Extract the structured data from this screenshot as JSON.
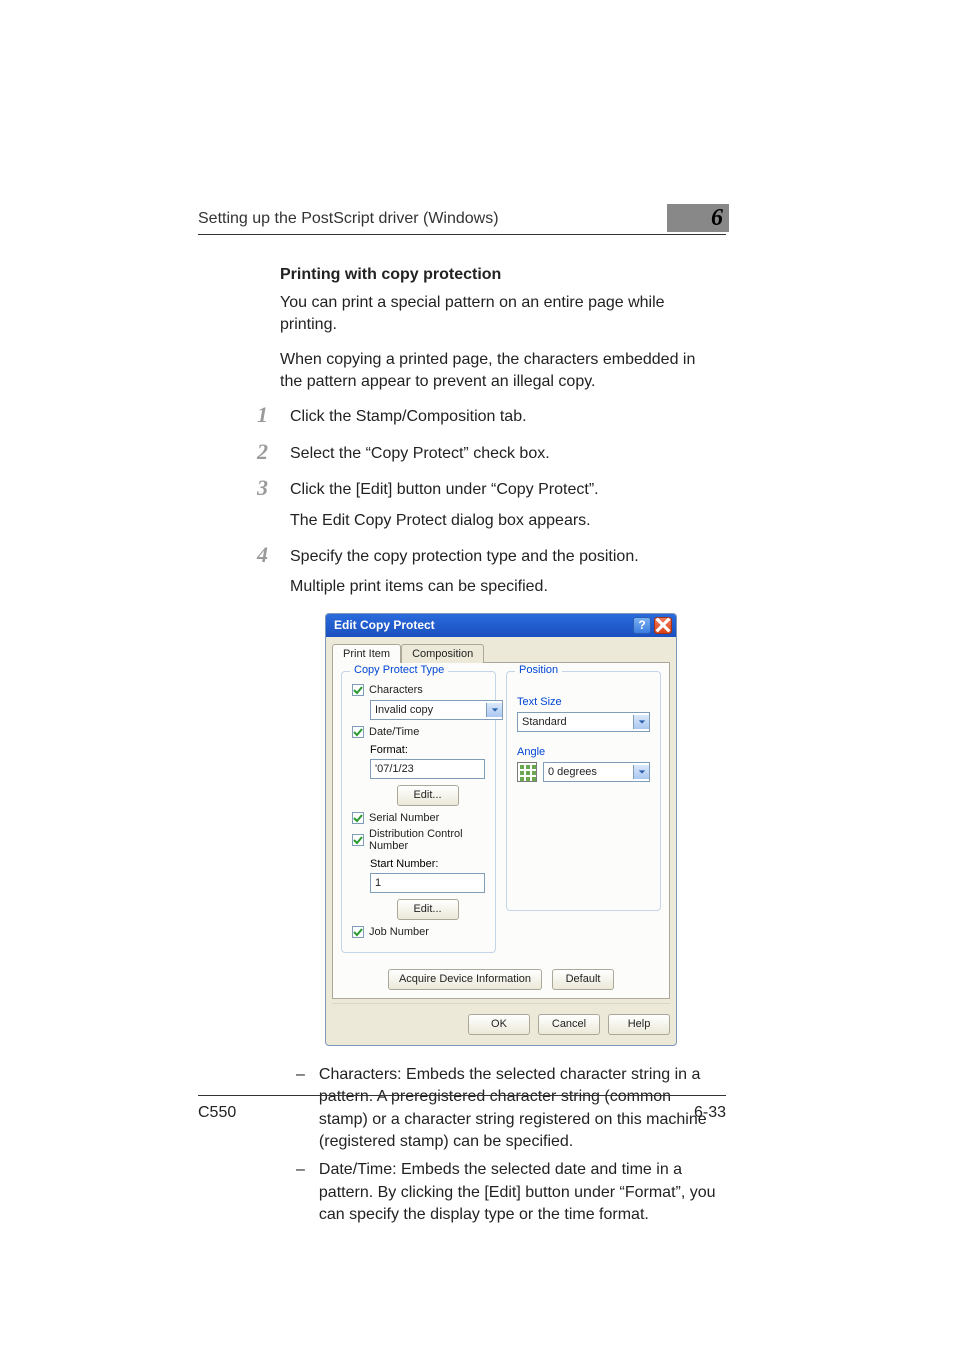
{
  "header": {
    "title": "Setting up the PostScript driver (Windows)",
    "chapter_number": "6"
  },
  "section": {
    "heading": "Printing with copy protection",
    "para1": "You can print a special pattern on an entire page while printing.",
    "para2": "When copying a printed page, the characters embedded in the pattern appear to prevent an illegal copy."
  },
  "steps": [
    {
      "num": "1",
      "text": "Click the Stamp/Composition tab."
    },
    {
      "num": "2",
      "text": "Select the “Copy Protect” check box."
    },
    {
      "num": "3",
      "text": "Click the [Edit] button under “Copy Protect”.",
      "sub": "The Edit Copy Protect dialog box appears."
    },
    {
      "num": "4",
      "text": "Specify the copy protection type and the position.",
      "sub": "Multiple print items can be specified."
    }
  ],
  "dialog": {
    "title": "Edit Copy Protect",
    "tabs": {
      "active": "Print Item",
      "inactive": "Composition"
    },
    "left": {
      "group_label": "Copy Protect Type",
      "characters_label": "Characters",
      "characters_value": "Invalid copy",
      "datetime_label": "Date/Time",
      "format_label": "Format:",
      "format_value": "'07/1/23",
      "edit1_label": "Edit...",
      "serial_label": "Serial Number",
      "dist_label": "Distribution Control Number",
      "start_number_label": "Start Number:",
      "start_number_value": "1",
      "edit2_label": "Edit...",
      "job_label": "Job Number"
    },
    "right": {
      "group_label": "Position",
      "textsize_label": "Text Size",
      "textsize_value": "Standard",
      "angle_label": "Angle",
      "angle_value": "0 degrees"
    },
    "buttons": {
      "acquire": "Acquire Device Information",
      "default": "Default",
      "ok": "OK",
      "cancel": "Cancel",
      "help": "Help"
    }
  },
  "bullets": {
    "b1": "Characters: Embeds the selected character string in a pattern. A preregistered character string (common stamp) or a character string registered on this machine (registered stamp) can be specified.",
    "b2": "Date/Time: Embeds the selected date and time in a pattern. By clicking the [Edit] button under “Format”, you can specify the display type or the time format."
  },
  "footer": {
    "left": "C550",
    "right": "6-33"
  }
}
